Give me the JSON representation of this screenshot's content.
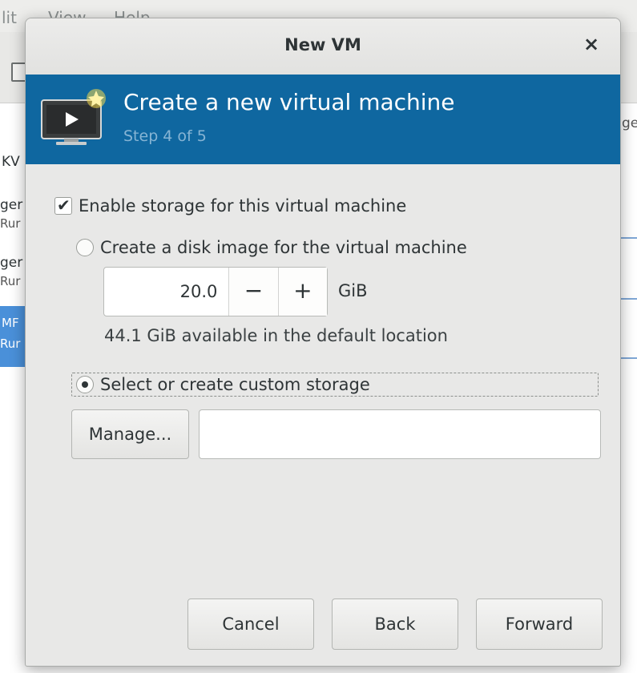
{
  "background_window": {
    "menu": [
      "lit",
      "View",
      "Help"
    ],
    "list_text": {
      "row0_name": "KV",
      "row1_name": "ger",
      "row1_status": "Rur",
      "row2_name": "ger",
      "row2_status": "Rur",
      "row3_name": "MF",
      "row3_status": "Rur",
      "column_cut": "ge"
    }
  },
  "dialog": {
    "title": "New VM",
    "close_glyph": "×",
    "banner": {
      "title": "Create a new virtual machine",
      "step": "Step 4 of 5",
      "icon": "virtual-machine-new-icon"
    },
    "enable_storage": {
      "label": "Enable storage for this virtual machine",
      "checked": true,
      "check_glyph": "✔"
    },
    "create_disk": {
      "label": "Create a disk image for the virtual machine",
      "selected": false,
      "size_value": "20.0",
      "decrement": "−",
      "increment": "+",
      "unit": "GiB",
      "available": "44.1 GiB available in the default location"
    },
    "custom_storage": {
      "label": "Select or create custom storage",
      "selected": true,
      "manage_button": "Manage...",
      "path_value": ""
    },
    "buttons": {
      "cancel": "Cancel",
      "back": "Back",
      "forward": "Forward"
    }
  },
  "colors": {
    "banner": "#0f67a0",
    "banner_step_text": "#86b4d4",
    "dialog_bg": "#e8e8e7",
    "selection_blue": "#4a90d9"
  }
}
